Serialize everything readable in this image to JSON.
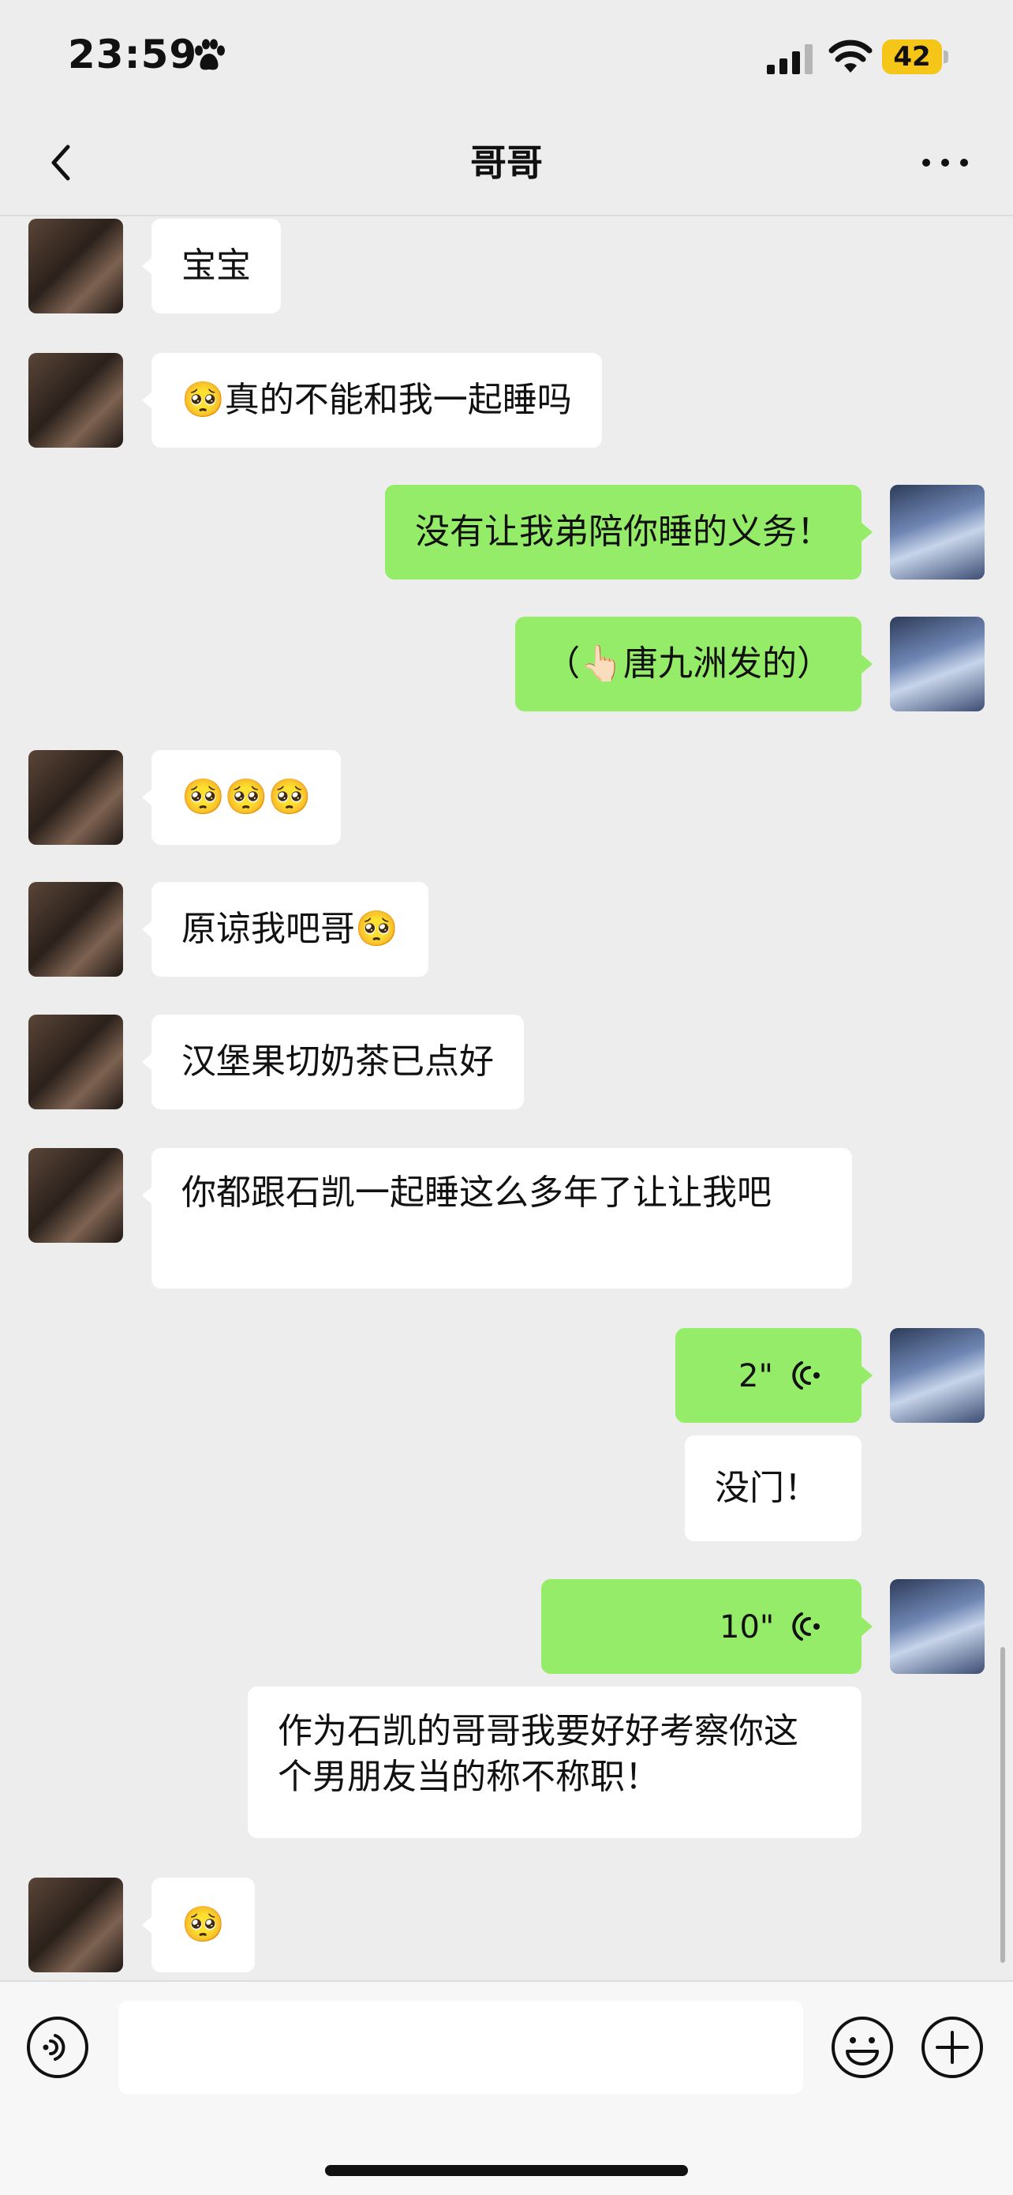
{
  "status_bar": {
    "time": "23:59",
    "battery": "42"
  },
  "nav": {
    "title": "哥哥"
  },
  "messages": [
    {
      "side": "left",
      "text": "宝宝"
    },
    {
      "side": "left",
      "text": "🥺真的不能和我一起睡吗"
    },
    {
      "side": "right",
      "text": "没有让我弟陪你睡的义务！"
    },
    {
      "side": "right",
      "text": "（👆🏻唐九洲发的）"
    },
    {
      "side": "left",
      "text": "🥺🥺🥺"
    },
    {
      "side": "left",
      "text": "原谅我吧哥🥺"
    },
    {
      "side": "left",
      "text": "汉堡果切奶茶已点好"
    },
    {
      "side": "left",
      "text": "你都跟石凯一起睡这么多年了让让我吧"
    },
    {
      "side": "right",
      "type": "voice",
      "duration": "2\""
    },
    {
      "side": "right",
      "text": "没门！"
    },
    {
      "side": "right",
      "type": "voice",
      "duration": "10\""
    },
    {
      "side": "right",
      "text": "作为石凯的哥哥我要好好考察你这个男朋友当的称不称职！"
    },
    {
      "side": "left",
      "text": "🥺"
    }
  ],
  "colors": {
    "self_bubble": "#95ec69",
    "other_bubble": "#ffffff",
    "background": "#ededed"
  },
  "icons": [
    "paw-icon",
    "signal-icon",
    "wifi-icon",
    "battery-icon",
    "back-chevron-icon",
    "more-icon",
    "voice-wave-icon",
    "voice-input-icon",
    "emoji-icon",
    "plus-icon"
  ]
}
